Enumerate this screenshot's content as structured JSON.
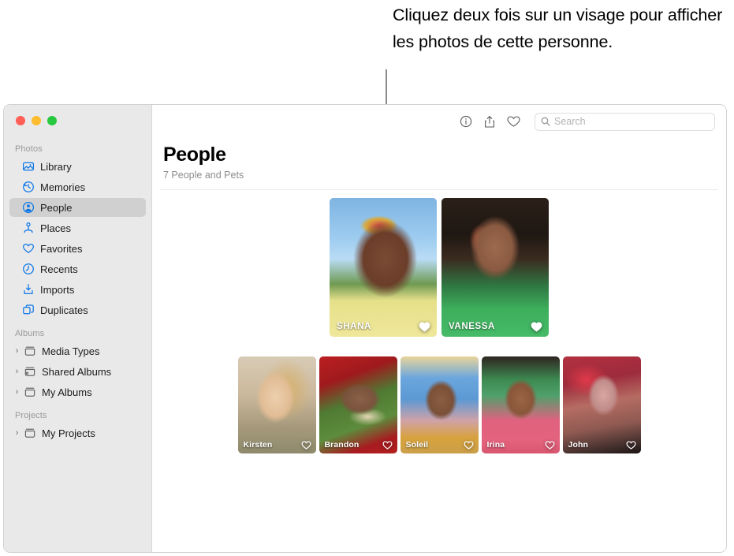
{
  "callout": {
    "text": "Cliquez deux fois sur un visage pour afficher les photos de cette personne."
  },
  "window": {
    "traffic_lights": {
      "close_label": "Close",
      "minimize_label": "Minimize",
      "zoom_label": "Zoom",
      "close_color": "#ff5f57",
      "minimize_color": "#febc2e",
      "zoom_color": "#28c840"
    }
  },
  "sidebar": {
    "sections": [
      {
        "title": "Photos",
        "items": [
          {
            "label": "Library",
            "icon": "library-icon",
            "selected": false
          },
          {
            "label": "Memories",
            "icon": "memories-icon",
            "selected": false
          },
          {
            "label": "People",
            "icon": "people-icon",
            "selected": true
          },
          {
            "label": "Places",
            "icon": "places-icon",
            "selected": false
          },
          {
            "label": "Favorites",
            "icon": "heart-icon",
            "selected": false
          },
          {
            "label": "Recents",
            "icon": "clock-icon",
            "selected": false
          },
          {
            "label": "Imports",
            "icon": "import-icon",
            "selected": false
          },
          {
            "label": "Duplicates",
            "icon": "duplicates-icon",
            "selected": false
          }
        ]
      },
      {
        "title": "Albums",
        "items": [
          {
            "label": "Media Types",
            "icon": "album-icon",
            "disclosure": "›"
          },
          {
            "label": "Shared Albums",
            "icon": "shared-album-icon",
            "disclosure": "›"
          },
          {
            "label": "My Albums",
            "icon": "album-icon",
            "disclosure": "›"
          }
        ]
      },
      {
        "title": "Projects",
        "items": [
          {
            "label": "My Projects",
            "icon": "album-icon",
            "disclosure": "›"
          }
        ]
      }
    ]
  },
  "toolbar": {
    "info_label": "Info",
    "share_label": "Share",
    "favorite_label": "Favorite",
    "search": {
      "placeholder": "Search",
      "value": ""
    }
  },
  "main": {
    "title": "People",
    "subtitle": "7 People and Pets"
  },
  "people": {
    "featured": [
      {
        "name": "SHANA",
        "favorite": true,
        "art": "ph-shana"
      },
      {
        "name": "VANESSA",
        "favorite": true,
        "art": "ph-vanessa"
      }
    ],
    "others": [
      {
        "name": "Kirsten",
        "favorite": false,
        "art": "ph-kirsten"
      },
      {
        "name": "Brandon",
        "favorite": false,
        "art": "ph-brandon"
      },
      {
        "name": "Soleil",
        "favorite": false,
        "art": "ph-soleil"
      },
      {
        "name": "Irina",
        "favorite": false,
        "art": "ph-irina"
      },
      {
        "name": "John",
        "favorite": false,
        "art": "ph-john"
      }
    ]
  }
}
